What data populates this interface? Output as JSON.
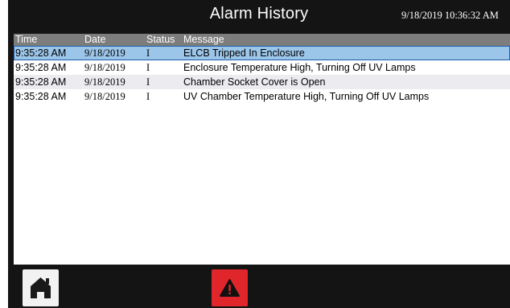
{
  "header": {
    "title": "Alarm History",
    "datetime": "9/18/2019 10:36:32 AM"
  },
  "table": {
    "columns": [
      "Time",
      "Date",
      "Status",
      "Message"
    ],
    "rows": [
      [
        "9:35:28 AM",
        "9/18/2019",
        "I",
        "ELCB Tripped In Enclosure"
      ],
      [
        "9:35:28 AM",
        "9/18/2019",
        "I",
        "Enclosure Temperature High, Turning Off UV Lamps"
      ],
      [
        "9:35:28 AM",
        "9/18/2019",
        "I",
        "Chamber Socket Cover is Open"
      ],
      [
        "9:35:28 AM",
        "9/18/2019",
        "I",
        "UV Chamber Temperature High, Turning Off UV Lamps"
      ]
    ],
    "selected_row": 0
  },
  "footer": {
    "buttons": [
      {
        "icon": "home-icon"
      },
      {
        "icon": "warning-icon"
      }
    ]
  },
  "colors": {
    "background": "#141414",
    "header_row": "#7d7d7d",
    "selected_row": "#9cc6e9",
    "alt_row": "#ebebf0",
    "alarm_button": "#e0262b"
  }
}
